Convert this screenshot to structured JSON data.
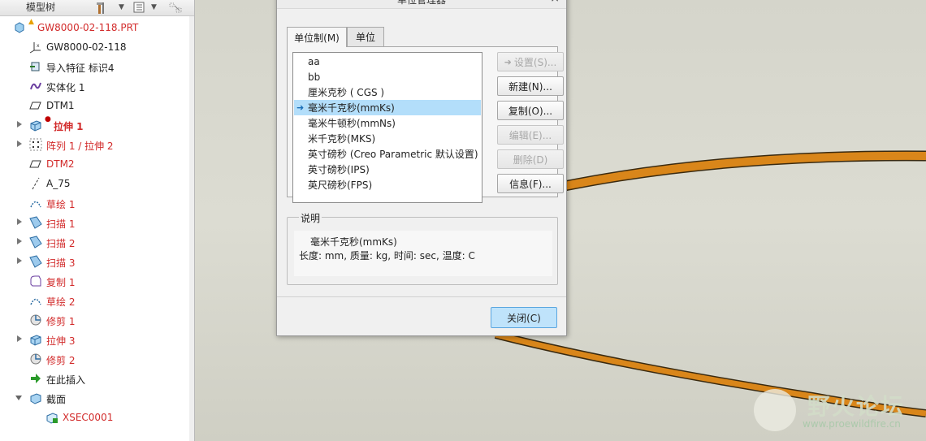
{
  "model_tree": {
    "title": "模型树",
    "items": [
      {
        "label": "GW8000-02-118.PRT",
        "icon": "part-icon",
        "color": "red",
        "expander": "none",
        "indent": 0,
        "badge": "warning"
      },
      {
        "label": "GW8000-02-118",
        "icon": "coordinate-system-icon",
        "color": "dark",
        "expander": "none",
        "indent": 1
      },
      {
        "label": "导入特征 标识4",
        "icon": "import-feature-icon",
        "color": "dark",
        "expander": "none",
        "indent": 1
      },
      {
        "label": "实体化 1",
        "icon": "solidify-icon",
        "color": "dark",
        "expander": "none",
        "indent": 1
      },
      {
        "label": "DTM1",
        "icon": "datum-plane-icon",
        "color": "dark",
        "expander": "none",
        "indent": 1
      },
      {
        "label": "拉伸 1",
        "icon": "extrude-icon",
        "color": "red",
        "expander": "closed",
        "indent": 1,
        "bold": true,
        "badge": "error"
      },
      {
        "label": "阵列 1 / 拉伸 2",
        "icon": "pattern-icon",
        "color": "red",
        "expander": "closed",
        "indent": 1
      },
      {
        "label": "DTM2",
        "icon": "datum-plane-icon",
        "color": "red",
        "expander": "none",
        "indent": 1
      },
      {
        "label": "A_75",
        "icon": "datum-axis-icon",
        "color": "dark",
        "expander": "none",
        "indent": 1
      },
      {
        "label": "草绘 1",
        "icon": "sketch-icon",
        "color": "red",
        "expander": "none",
        "indent": 1
      },
      {
        "label": "扫描 1",
        "icon": "sweep-icon",
        "color": "red",
        "expander": "closed",
        "indent": 1
      },
      {
        "label": "扫描 2",
        "icon": "sweep-icon",
        "color": "red",
        "expander": "closed",
        "indent": 1
      },
      {
        "label": "扫描 3",
        "icon": "sweep-icon",
        "color": "red",
        "expander": "closed",
        "indent": 1
      },
      {
        "label": "复制 1",
        "icon": "copy-feature-icon",
        "color": "red",
        "expander": "none",
        "indent": 1
      },
      {
        "label": "草绘 2",
        "icon": "sketch-icon",
        "color": "red",
        "expander": "none",
        "indent": 1
      },
      {
        "label": "修剪 1",
        "icon": "trim-icon",
        "color": "red",
        "expander": "none",
        "indent": 1
      },
      {
        "label": "拉伸 3",
        "icon": "extrude-icon",
        "color": "red",
        "expander": "closed",
        "indent": 1
      },
      {
        "label": "修剪 2",
        "icon": "trim-icon",
        "color": "red",
        "expander": "none",
        "indent": 1
      },
      {
        "label": "在此插入",
        "icon": "insert-here-icon",
        "color": "dark",
        "expander": "none",
        "indent": 1
      },
      {
        "label": "截面",
        "icon": "section-icon",
        "color": "dark",
        "expander": "open",
        "indent": 1
      },
      {
        "label": "XSEC0001",
        "icon": "xsection-icon",
        "color": "red",
        "expander": "none",
        "indent": 2
      }
    ]
  },
  "dialog": {
    "title": "单位管理器",
    "close_glyph": "×",
    "tabs": [
      {
        "label": "单位制(M)",
        "active": true
      },
      {
        "label": "单位",
        "active": false
      }
    ],
    "unit_systems": [
      {
        "label": "aa",
        "selected": false
      },
      {
        "label": "bb",
        "selected": false
      },
      {
        "label": "厘米克秒 ( CGS )",
        "selected": false
      },
      {
        "label": "毫米千克秒(mmKs)",
        "selected": true
      },
      {
        "label": "毫米牛顿秒(mmNs)",
        "selected": false
      },
      {
        "label": "米千克秒(MKS)",
        "selected": false
      },
      {
        "label": "英寸磅秒 (Creo Parametric 默认设置)",
        "selected": false
      },
      {
        "label": "英寸磅秒(IPS)",
        "selected": false
      },
      {
        "label": "英尺磅秒(FPS)",
        "selected": false
      }
    ],
    "buttons": [
      {
        "name": "set-button",
        "label": "设置(S)...",
        "enabled": false,
        "arrow": true
      },
      {
        "name": "new-button",
        "label": "新建(N)...",
        "enabled": true
      },
      {
        "name": "copy-button",
        "label": "复制(O)...",
        "enabled": true
      },
      {
        "name": "edit-button",
        "label": "编辑(E)...",
        "enabled": false
      },
      {
        "name": "delete-button",
        "label": "删除(D)",
        "enabled": false
      },
      {
        "name": "info-button",
        "label": "信息(F)...",
        "enabled": true
      }
    ],
    "description": {
      "legend": "说明",
      "line1": "毫米千克秒(mmKs)",
      "line2": "长度: mm, 质量: kg, 时间: sec, 温度: C"
    },
    "close_label": "关闭(C)"
  },
  "watermark": {
    "text": "野火论坛",
    "url": "www.proewildfire.cn"
  },
  "colors": {
    "feature_red": "#d22b2b",
    "selection_blue": "#b3defa",
    "ring_orange": "#d9861a",
    "ring_edge": "#3a2a10",
    "canvas_bg": "#d6d6cc"
  }
}
